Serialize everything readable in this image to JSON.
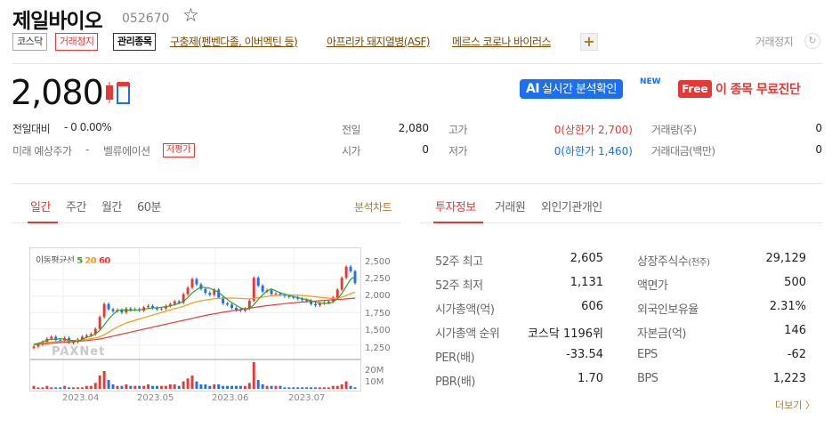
{
  "header": {
    "name": "제일바이오",
    "code": "052670",
    "tags": {
      "market": "코스닥",
      "halt": "거래정지",
      "managed": "관리종목"
    },
    "themes": [
      "구충제(펜벤다졸, 이버멕틴 등)",
      "아프리카 돼지열병(ASF)",
      "메르스 코로나 바이러스"
    ],
    "plus": "+",
    "status_right": "거래정지",
    "refresh_icon": "refresh-icon"
  },
  "price": {
    "current": "2,080",
    "change_label": "전일대비",
    "change_value": "- 0 0.00%",
    "future_label": "미래 예상주가",
    "future_value": "-",
    "valuation_label": "벨류에이션",
    "valuation_badge": "저평가"
  },
  "promo": {
    "ai_prefix": "AI",
    "ai_text": "실시간 분석확인",
    "new": "NEW",
    "free_badge": "Free",
    "free_text": "이 종목 무료진단"
  },
  "stats": {
    "prev_label": "전일",
    "prev_value": "2,080",
    "open_label": "시가",
    "open_value": "0",
    "high_label": "고가",
    "high_value": "0(상한가 2,700)",
    "low_label": "저가",
    "low_value": "0(하한가 1,460)",
    "volume_label": "거래량(주)",
    "volume_value": "0",
    "amount_label": "거래대금(백만)",
    "amount_value": "0"
  },
  "chart_tabs": {
    "items": [
      "일간",
      "주간",
      "월간",
      "60분"
    ],
    "active": 0,
    "more": "분석차트"
  },
  "chart_data": {
    "type": "candlestick",
    "title": "",
    "legend": {
      "label": "이동평균선",
      "ma": [
        "5",
        "20",
        "60"
      ]
    },
    "colors": {
      "ma5": "#2aa52a",
      "ma20": "#f39a16",
      "ma60": "#e53935",
      "up": "#e53935",
      "down": "#1d6ff2"
    },
    "y_ticks": [
      "2,500",
      "2,250",
      "2,000",
      "1,750",
      "1,500",
      "1,250"
    ],
    "ylim": [
      1100,
      2650
    ],
    "volume_ticks": [
      "20M",
      "10M"
    ],
    "x_ticks": [
      "2023.04",
      "2023.05",
      "2023.06",
      "2023.07"
    ],
    "watermark": "PAXNet",
    "close": [
      1230,
      1260,
      1300,
      1350,
      1380,
      1330,
      1320,
      1360,
      1290,
      1300,
      1340,
      1380,
      1400,
      1420,
      1500,
      1680,
      1880,
      1800,
      1770,
      1790,
      1750,
      1810,
      1790,
      1800,
      1780,
      1830,
      1850,
      1820,
      1800,
      1810,
      1850,
      1880,
      1920,
      1900,
      2030,
      2130,
      2260,
      2180,
      2110,
      2050,
      2020,
      2100,
      1980,
      1890,
      1870,
      1820,
      1790,
      1780,
      1810,
      1930,
      2280,
      2160,
      2070,
      2090,
      2030,
      2040,
      2020,
      2000,
      1990,
      1980,
      1960,
      1940,
      1930,
      1880,
      1860,
      1890,
      1900,
      1920,
      1980,
      2100,
      2280,
      2450,
      2380,
      2200
    ],
    "ma5": [
      1260,
      1280,
      1300,
      1330,
      1340,
      1340,
      1350,
      1340,
      1330,
      1320,
      1310,
      1340,
      1370,
      1390,
      1420,
      1480,
      1560,
      1650,
      1720,
      1780,
      1790,
      1790,
      1780,
      1790,
      1790,
      1800,
      1810,
      1820,
      1820,
      1830,
      1840,
      1850,
      1870,
      1890,
      1920,
      1980,
      2050,
      2100,
      2140,
      2130,
      2120,
      2090,
      2060,
      2000,
      1950,
      1900,
      1860,
      1820,
      1800,
      1810,
      1870,
      1950,
      2020,
      2080,
      2110,
      2080,
      2050,
      2030,
      2010,
      1990,
      1980,
      1960,
      1950,
      1930,
      1910,
      1890,
      1890,
      1890,
      1910,
      1960,
      2040,
      2150,
      2260,
      2300
    ],
    "ma20": [
      1270,
      1275,
      1280,
      1290,
      1300,
      1305,
      1310,
      1315,
      1320,
      1322,
      1325,
      1330,
      1340,
      1350,
      1360,
      1380,
      1410,
      1450,
      1490,
      1530,
      1560,
      1590,
      1610,
      1630,
      1650,
      1670,
      1690,
      1710,
      1730,
      1750,
      1770,
      1790,
      1810,
      1825,
      1845,
      1870,
      1895,
      1915,
      1930,
      1940,
      1950,
      1960,
      1965,
      1968,
      1970,
      1970,
      1968,
      1965,
      1960,
      1958,
      1965,
      1975,
      1985,
      1995,
      2005,
      2010,
      2015,
      2018,
      2020,
      2018,
      2015,
      2010,
      2005,
      1998,
      1990,
      1982,
      1976,
      1970,
      1965,
      1970,
      1985,
      2010,
      2040,
      2060
    ],
    "ma60": [
      1260,
      1265,
      1270,
      1275,
      1280,
      1285,
      1290,
      1295,
      1300,
      1305,
      1310,
      1315,
      1320,
      1328,
      1335,
      1345,
      1360,
      1375,
      1390,
      1405,
      1420,
      1435,
      1450,
      1465,
      1480,
      1495,
      1510,
      1525,
      1540,
      1555,
      1570,
      1585,
      1600,
      1615,
      1630,
      1645,
      1660,
      1675,
      1690,
      1705,
      1718,
      1730,
      1742,
      1754,
      1765,
      1775,
      1785,
      1795,
      1805,
      1815,
      1825,
      1835,
      1845,
      1855,
      1862,
      1870,
      1878,
      1885,
      1892,
      1898,
      1904,
      1910,
      1915,
      1920,
      1925,
      1930,
      1935,
      1940,
      1944,
      1948,
      1953,
      1958,
      1964,
      1970
    ],
    "volume": [
      2,
      1,
      1,
      2,
      1,
      1,
      1,
      2,
      1,
      1,
      1,
      1,
      2,
      2,
      4,
      9,
      12,
      6,
      3,
      2,
      2,
      3,
      2,
      2,
      2,
      2,
      3,
      2,
      2,
      2,
      2,
      3,
      3,
      2,
      5,
      7,
      9,
      5,
      3,
      3,
      2,
      3,
      3,
      2,
      2,
      2,
      2,
      2,
      2,
      4,
      18,
      6,
      3,
      2,
      2,
      2,
      2,
      1,
      1,
      1,
      1,
      1,
      1,
      1,
      1,
      1,
      1,
      1,
      2,
      2,
      3,
      5,
      2,
      1
    ]
  },
  "info_tabs": {
    "items": [
      "투자정보",
      "거래원",
      "외인기관개인"
    ],
    "active": 0
  },
  "info": {
    "rows": [
      {
        "l1": "52주 최고",
        "v1": "2,605",
        "l2": "상장주식수",
        "l2s": "(천주)",
        "v2": "29,129"
      },
      {
        "l1": "52주 최저",
        "v1": "1,131",
        "l2": "액면가",
        "l2s": "",
        "v2": "500"
      },
      {
        "l1": "시가총액(억)",
        "v1": "606",
        "l2": "외국인보유율",
        "l2s": "",
        "v2": "2.31%"
      },
      {
        "l1": "시가총액 순위",
        "v1": "코스닥 1196위",
        "l2": "자본금(억)",
        "l2s": "",
        "v2": "146"
      },
      {
        "l1": "PER(배)",
        "v1": "-33.54",
        "l2": "EPS",
        "l2s": "",
        "v2": "-62"
      },
      {
        "l1": "PBR(배)",
        "v1": "1.70",
        "l2": "BPS",
        "l2s": "",
        "v2": "1,223"
      }
    ],
    "more": "더보기 〉"
  }
}
